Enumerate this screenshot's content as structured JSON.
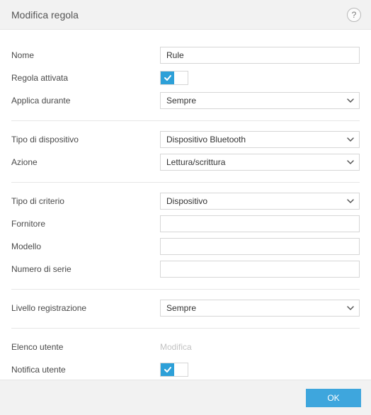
{
  "header": {
    "title": "Modifica regola"
  },
  "fields": {
    "name": {
      "label": "Nome",
      "value": "Rule"
    },
    "enabled": {
      "label": "Regola attivata"
    },
    "apply": {
      "label": "Applica durante",
      "value": "Sempre"
    },
    "devtype": {
      "label": "Tipo di dispositivo",
      "value": "Dispositivo Bluetooth"
    },
    "action": {
      "label": "Azione",
      "value": "Lettura/scrittura"
    },
    "crittype": {
      "label": "Tipo di criterio",
      "value": "Dispositivo"
    },
    "vendor": {
      "label": "Fornitore",
      "value": ""
    },
    "model": {
      "label": "Modello",
      "value": ""
    },
    "serial": {
      "label": "Numero di serie",
      "value": ""
    },
    "loglevel": {
      "label": "Livello registrazione",
      "value": "Sempre"
    },
    "userlist": {
      "label": "Elenco utente",
      "link": "Modifica"
    },
    "notify": {
      "label": "Notifica utente"
    }
  },
  "footer": {
    "ok": "OK"
  },
  "icons": {
    "help": "help-icon",
    "chevron": "chevron-down-icon",
    "check": "check-icon"
  }
}
